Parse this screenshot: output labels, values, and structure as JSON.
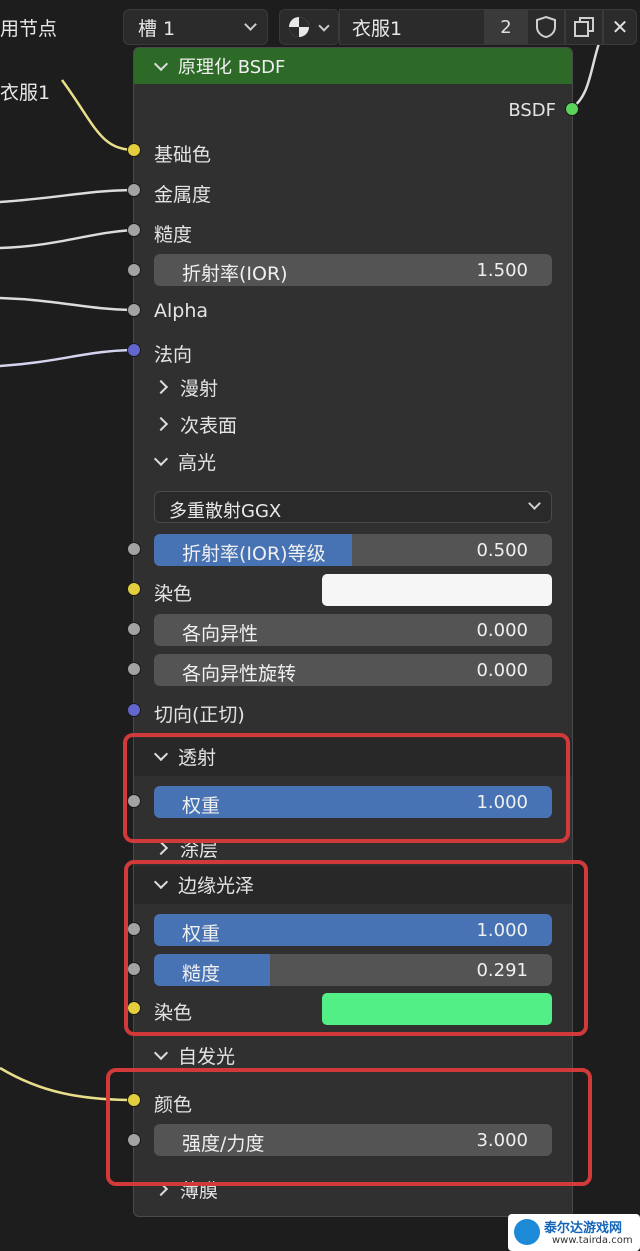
{
  "header": {
    "left_fragment": "用节点",
    "slot_label": "槽 1",
    "material_name": "衣服1",
    "user_count": "2",
    "side_label": "衣服1"
  },
  "node": {
    "title": "原理化 BSDF",
    "output": "BSDF",
    "inputs": {
      "base_color": "基础色",
      "metallic": "金属度",
      "roughness": "糙度",
      "alpha": "Alpha",
      "normal": "法向",
      "tangent": "切向(正切)"
    },
    "ior": {
      "label": "折射率(IOR)",
      "value": "1.500"
    },
    "panels": {
      "diffuse": "漫射",
      "subsurface": "次表面",
      "specular": "高光",
      "transmission": "透射",
      "coat": "涂层",
      "sheen": "边缘光泽",
      "emission": "自发光",
      "thin_film": "薄膜"
    },
    "specular": {
      "distribution": "多重散射GGX",
      "ior_level": {
        "label": "折射率(IOR)等级",
        "value": "0.500",
        "fraction": 0.5
      },
      "tint_label": "染色",
      "tint_color": "#f6f6f6",
      "anisotropic": {
        "label": "各向异性",
        "value": "0.000",
        "fraction": 0
      },
      "anisotropic_rotation": {
        "label": "各向异性旋转",
        "value": "0.000",
        "fraction": 0
      }
    },
    "transmission": {
      "weight": {
        "label": "权重",
        "value": "1.000",
        "fraction": 1
      }
    },
    "sheen": {
      "weight": {
        "label": "权重",
        "value": "1.000",
        "fraction": 1
      },
      "roughness": {
        "label": "糙度",
        "value": "0.291",
        "fraction": 0.291
      },
      "tint_label": "染色",
      "tint_color": "#52ef86"
    },
    "emission": {
      "color_label": "颜色",
      "strength": {
        "label": "强度/力度",
        "value": "3.000",
        "fraction": 0
      }
    }
  },
  "watermark": {
    "name": "泰尔达游戏网",
    "url": "www.tairda.com"
  },
  "colors": {
    "node_header": "#2d6a28",
    "slider_fill": "#4772b3",
    "socket_color": "#e3cf3e",
    "socket_float": "#a3a3a3",
    "socket_vector": "#6465cf",
    "socket_shader": "#5bd25b",
    "highlight": "#d23a3a"
  }
}
